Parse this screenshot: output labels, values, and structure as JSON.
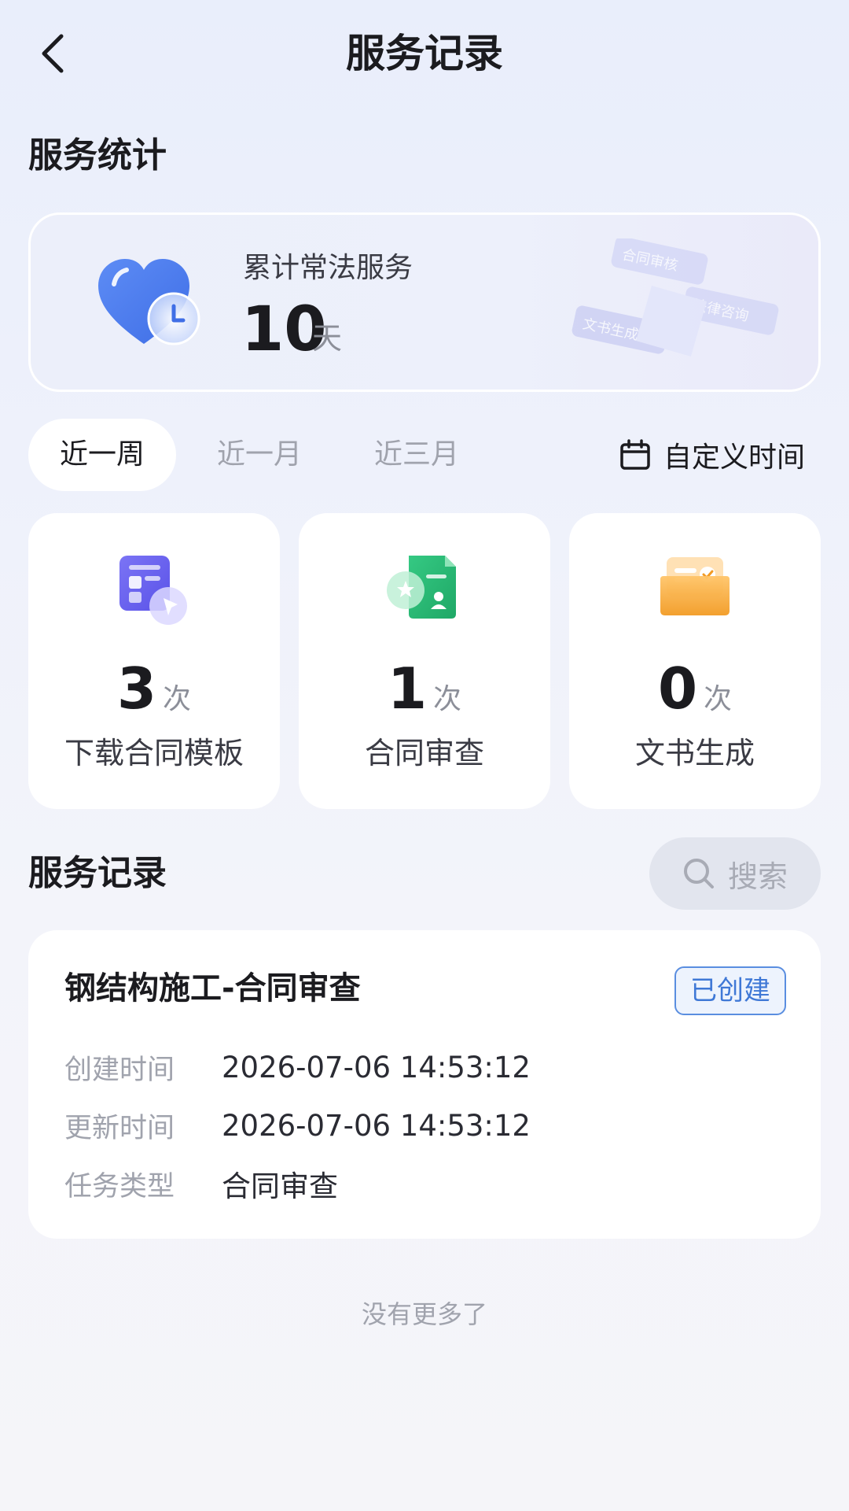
{
  "header": {
    "title": "服务记录"
  },
  "stats_section": {
    "title": "服务统计"
  },
  "summary": {
    "label": "累计常法服务",
    "value": "10",
    "unit": "天",
    "deco_tags": [
      "合同审核",
      "法律咨询",
      "文书生成"
    ]
  },
  "period_tabs": [
    {
      "label": "近一周",
      "active": true
    },
    {
      "label": "近一月",
      "active": false
    },
    {
      "label": "近三月",
      "active": false
    }
  ],
  "custom_time": {
    "label": "自定义时间"
  },
  "stat_cards": [
    {
      "value": "3",
      "unit": "次",
      "label": "下载合同模板",
      "icon": "template-download-icon"
    },
    {
      "value": "1",
      "unit": "次",
      "label": "合同审查",
      "icon": "contract-review-icon"
    },
    {
      "value": "0",
      "unit": "次",
      "label": "文书生成",
      "icon": "document-generate-icon"
    }
  ],
  "records_section": {
    "title": "服务记录",
    "search_label": "搜索"
  },
  "records": [
    {
      "title": "钢结构施工-合同审查",
      "status": "已创建",
      "fields": [
        {
          "label": "创建时间",
          "value": "2026-07-06 14:53:12"
        },
        {
          "label": "更新时间",
          "value": "2026-07-06 14:53:12"
        },
        {
          "label": "任务类型",
          "value": "合同审查"
        }
      ]
    }
  ],
  "footer": {
    "no_more": "没有更多了"
  },
  "colors": {
    "accent": "#3f78d6",
    "heart": "#4f7ff0",
    "purple": "#6b63f0",
    "green": "#2fbf78",
    "orange": "#f5a93a"
  }
}
